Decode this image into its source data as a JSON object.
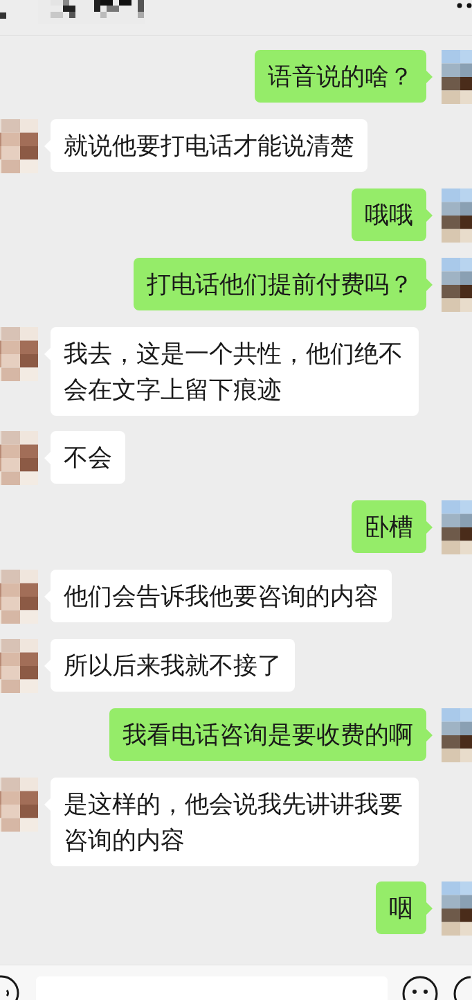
{
  "messages": [
    {
      "outgoing": true,
      "text": "语音说的啥？"
    },
    {
      "outgoing": false,
      "text": "就说他要打电话才能说清楚"
    },
    {
      "outgoing": true,
      "text": "哦哦"
    },
    {
      "outgoing": true,
      "text": "打电话他们提前付费吗？"
    },
    {
      "outgoing": false,
      "text": "我去，这是一个共性，他们绝不会在文字上留下痕迹"
    },
    {
      "outgoing": false,
      "text": "不会"
    },
    {
      "outgoing": true,
      "text": "卧槽"
    },
    {
      "outgoing": false,
      "text": "他们会告诉我他要咨询的内容"
    },
    {
      "outgoing": false,
      "text": "所以后来我就不接了"
    },
    {
      "outgoing": true,
      "text": "我看电话咨询是要收费的啊"
    },
    {
      "outgoing": false,
      "text": "是这样的，他会说我先讲讲我要咨询的内容"
    },
    {
      "outgoing": true,
      "text": "咽"
    }
  ]
}
